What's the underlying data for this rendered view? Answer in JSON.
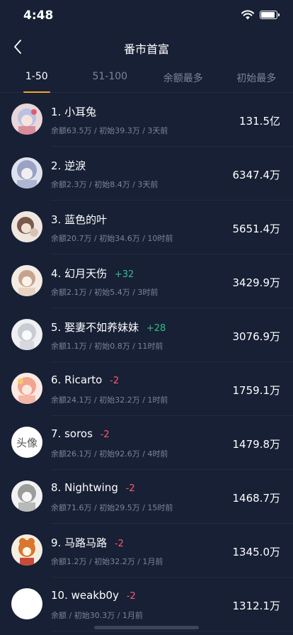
{
  "status": {
    "time": "4:48"
  },
  "nav": {
    "title": "番市首富"
  },
  "tabs": [
    {
      "label": "1-50",
      "active": true
    },
    {
      "label": "51-100",
      "active": false
    },
    {
      "label": "余额最多",
      "active": false
    },
    {
      "label": "初始最多",
      "active": false
    }
  ],
  "rows": [
    {
      "rank": "1.",
      "name": "小耳兔",
      "delta": "",
      "balance": "余额63.5万",
      "initial": "初始39.3万",
      "time": "3天前",
      "amount": "131.5亿"
    },
    {
      "rank": "2.",
      "name": "逆淚",
      "delta": "",
      "balance": "余额2.3万",
      "initial": "初始8.4万",
      "time": "3天前",
      "amount": "6347.4万"
    },
    {
      "rank": "3.",
      "name": "蓝色的叶",
      "delta": "",
      "balance": "余额20.7万",
      "initial": "初始34.6万",
      "time": "10时前",
      "amount": "5651.4万"
    },
    {
      "rank": "4.",
      "name": "幻月天伤",
      "delta": "+32",
      "balance": "余额2.1万",
      "initial": "初始5.4万",
      "time": "3时前",
      "amount": "3429.9万"
    },
    {
      "rank": "5.",
      "name": "娶妻不如养妹妹",
      "delta": "+28",
      "balance": "余额1.1万",
      "initial": "初始0.8万",
      "time": "11时前",
      "amount": "3076.9万"
    },
    {
      "rank": "6.",
      "name": "Ricarto",
      "delta": "-2",
      "balance": "余额24.1万",
      "initial": "初始32.2万",
      "time": "1时前",
      "amount": "1759.1万"
    },
    {
      "rank": "7.",
      "name": "soros",
      "delta": "-2",
      "balance": "余额26.1万",
      "initial": "初始92.6万",
      "time": "4时前",
      "amount": "1479.8万"
    },
    {
      "rank": "8.",
      "name": "Nightwing",
      "delta": "-2",
      "balance": "余额71.6万",
      "initial": "初始29.5万",
      "time": "15时前",
      "amount": "1468.7万"
    },
    {
      "rank": "9.",
      "name": "马路马路",
      "delta": "-2",
      "balance": "余额1.2万",
      "initial": "初始32.2万",
      "time": "1月前",
      "amount": "1345.0万"
    },
    {
      "rank": "10.",
      "name": "weakb0y",
      "delta": "-2",
      "balance": "余额",
      "initial": "初始30.3万",
      "time": "1月前",
      "amount": "1312.1万"
    }
  ],
  "avatar_text": {
    "row7": "头像"
  },
  "colors": {
    "background": "#172035",
    "accent": "#f5a623",
    "up": "#2fbf8a",
    "down": "#ff5a6a",
    "muted": "#7b859a"
  }
}
